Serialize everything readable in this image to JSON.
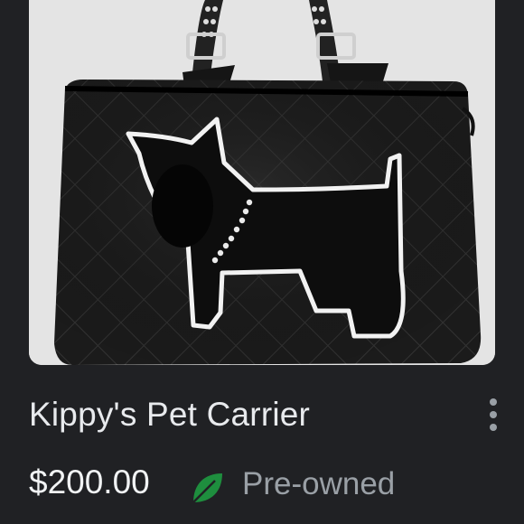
{
  "listing": {
    "title": "Kippy's Pet Carrier",
    "price": "$200.00",
    "condition": "Pre-owned"
  },
  "icons": {
    "condition": "leaf-icon",
    "menu": "more-vert-icon"
  },
  "colors": {
    "background": "#202124",
    "title_text": "#e8eaed",
    "condition_text": "#9aa0a6",
    "leaf": "#1e8e3e"
  }
}
